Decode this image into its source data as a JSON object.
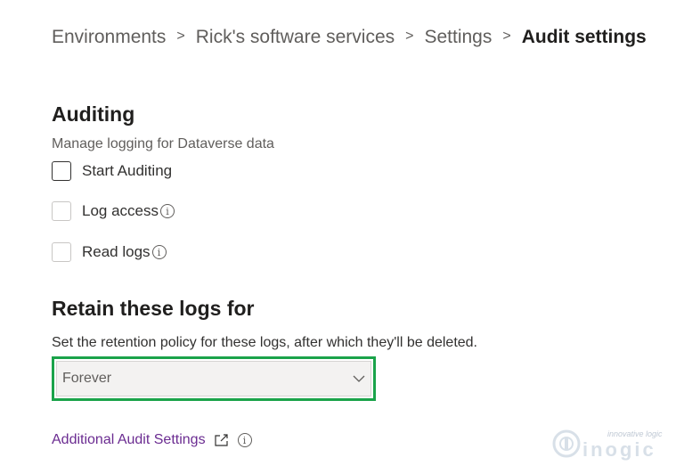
{
  "breadcrumb": {
    "items": [
      "Environments",
      "Rick's software services",
      "Settings"
    ],
    "current": "Audit settings",
    "separator": ">"
  },
  "auditing": {
    "title": "Auditing",
    "subtitle": "Manage logging for Dataverse data",
    "options": [
      {
        "label": "Start Auditing",
        "checked": false,
        "enabled": true
      },
      {
        "label": "Log access",
        "checked": false,
        "enabled": false
      },
      {
        "label": "Read logs",
        "checked": false,
        "enabled": false
      }
    ]
  },
  "retention": {
    "title": "Retain these logs for",
    "subtitle": "Set the retention policy for these logs, after which they'll be deleted.",
    "selected": "Forever"
  },
  "footer": {
    "link_label": "Additional Audit Settings"
  },
  "watermark": {
    "tagline": "innovative logic",
    "brand": "inogic"
  },
  "colors": {
    "highlight_border": "#1aa34a",
    "link": "#6b2c91"
  },
  "icons": {
    "info": "info-icon",
    "external_link": "external-link-icon",
    "dropdown": "chevron-down-icon"
  }
}
